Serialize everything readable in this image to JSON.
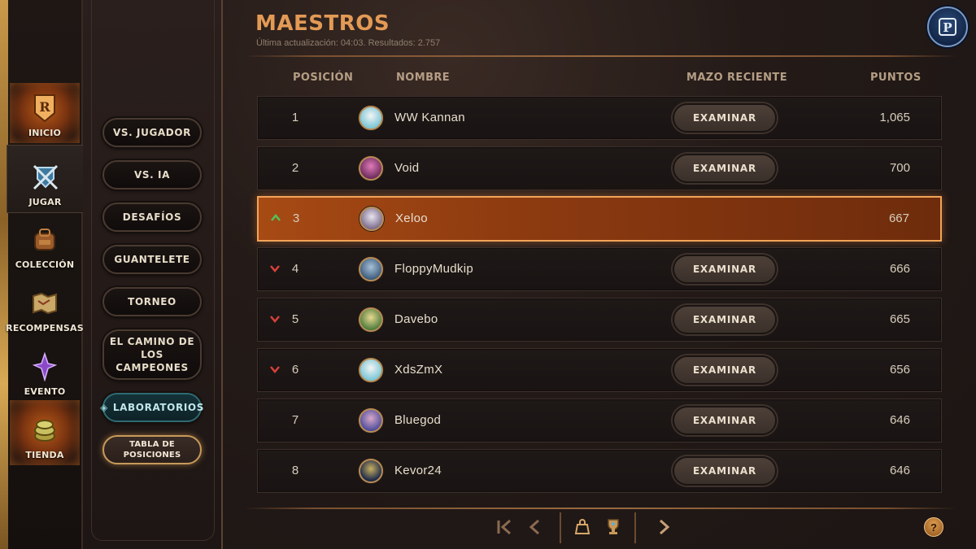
{
  "rail": {
    "items": [
      {
        "label": "INICIO",
        "icon": "home-crest-icon"
      },
      {
        "label": "JUGAR",
        "icon": "crossed-swords-shield-icon"
      },
      {
        "label": "COLECCIÓN",
        "icon": "backpack-icon"
      },
      {
        "label": "RECOMPENSAS",
        "icon": "scroll-map-icon"
      },
      {
        "label": "EVENTO",
        "icon": "purple-star-icon"
      },
      {
        "label": "TIENDA",
        "icon": "coins-icon"
      }
    ]
  },
  "submenu": {
    "items": [
      {
        "label": "VS. JUGADOR"
      },
      {
        "label": "VS. IA"
      },
      {
        "label": "DESAFÍOS"
      },
      {
        "label": "GUANTELETE"
      },
      {
        "label": "TORNEO"
      },
      {
        "label": "EL CAMINO DE LOS CAMPEONES"
      },
      {
        "label": "LABORATORIOS"
      },
      {
        "label": "TABLA DE POSICIONES"
      }
    ]
  },
  "header": {
    "title": "MAESTROS",
    "subtitle": "Última actualización: 04:03. Resultados: 2.757"
  },
  "columns": {
    "position": "POSICIÓN",
    "name": "NOMBRE",
    "deck": "MAZO RECIENTE",
    "points": "PUNTOS"
  },
  "rows": [
    {
      "rank": "1",
      "name": "WW Kannan",
      "points": "1,065",
      "trend": "none",
      "button": "EXAMINAR",
      "avatar_color": "#7fc8d8"
    },
    {
      "rank": "2",
      "name": "Void",
      "points": "700",
      "trend": "none",
      "button": "EXAMINAR",
      "avatar_color": "#b04a8a"
    },
    {
      "rank": "3",
      "name": "Xeloo",
      "points": "667",
      "trend": "up",
      "button": "",
      "avatar_color": "#9a8aa8"
    },
    {
      "rank": "4",
      "name": "FloppyMudkip",
      "points": "666",
      "trend": "down",
      "button": "EXAMINAR",
      "avatar_color": "#5a7a9a"
    },
    {
      "rank": "5",
      "name": "Davebo",
      "points": "665",
      "trend": "down",
      "button": "EXAMINAR",
      "avatar_color": "#6a9a4a"
    },
    {
      "rank": "6",
      "name": "XdsZmX",
      "points": "656",
      "trend": "down",
      "button": "EXAMINAR",
      "avatar_color": "#7fc8d8"
    },
    {
      "rank": "7",
      "name": "Bluegod",
      "points": "646",
      "trend": "none",
      "button": "EXAMINAR",
      "avatar_color": "#5a5aa8"
    },
    {
      "rank": "8",
      "name": "Kevor24",
      "points": "646",
      "trend": "none",
      "button": "EXAMINAR",
      "avatar_color": "#2a3a5a"
    }
  ],
  "pager": {
    "icons": [
      "first-page-icon",
      "prev-page-icon",
      "region-bag-icon",
      "trophy-icon",
      "next-page-icon"
    ]
  },
  "help": {
    "label": "?"
  },
  "colors": {
    "accent": "#e39a55",
    "highlight_row": "#a74a14",
    "trend_up": "#4fc45a",
    "trend_down": "#d8403a"
  }
}
